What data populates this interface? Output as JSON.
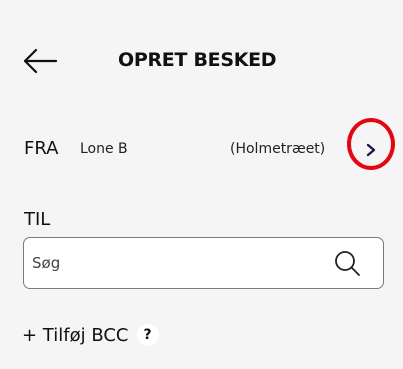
{
  "header": {
    "title": "OPRET BESKED",
    "back_icon": "arrow-left-icon"
  },
  "from": {
    "label": "FRA",
    "name": "Lone B",
    "org": "(Holmetræet)",
    "chevron_icon": "chevron-right-icon",
    "highlight_color": "#e30613"
  },
  "to": {
    "label": "TIL",
    "search_placeholder": "Søg",
    "search_icon": "search-icon"
  },
  "bcc": {
    "label": "+ Tilføj BCC",
    "help_glyph": "?"
  },
  "colors": {
    "background": "#f5f5f5",
    "text": "#111111",
    "input_border": "#7a7a7a"
  }
}
